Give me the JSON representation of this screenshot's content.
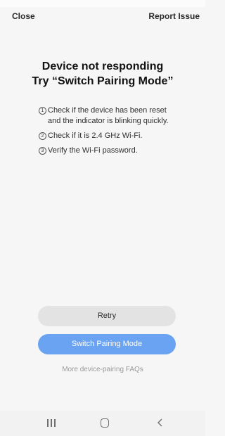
{
  "header": {
    "close_label": "Close",
    "report_label": "Report Issue"
  },
  "title": {
    "line1": "Device not responding",
    "line2": "Try “Switch Pairing Mode”"
  },
  "steps": [
    {
      "num": "1",
      "text": "Check if the device has been reset and the indicator is blinking quickly."
    },
    {
      "num": "2",
      "text": "Check if it is 2.4 GHz Wi-Fi."
    },
    {
      "num": "3",
      "text": "Verify the Wi-Fi password."
    }
  ],
  "buttons": {
    "retry_label": "Retry",
    "switch_label": "Switch Pairing Mode"
  },
  "faq_link": "More device-pairing FAQs",
  "nav": {
    "recent_icon": "recent-apps-icon",
    "home_icon": "home-icon",
    "back_icon": "back-icon"
  },
  "colors": {
    "primary_button": "#6aa3f2",
    "secondary_button": "#e3e3e3",
    "background": "#f6f6f6"
  }
}
